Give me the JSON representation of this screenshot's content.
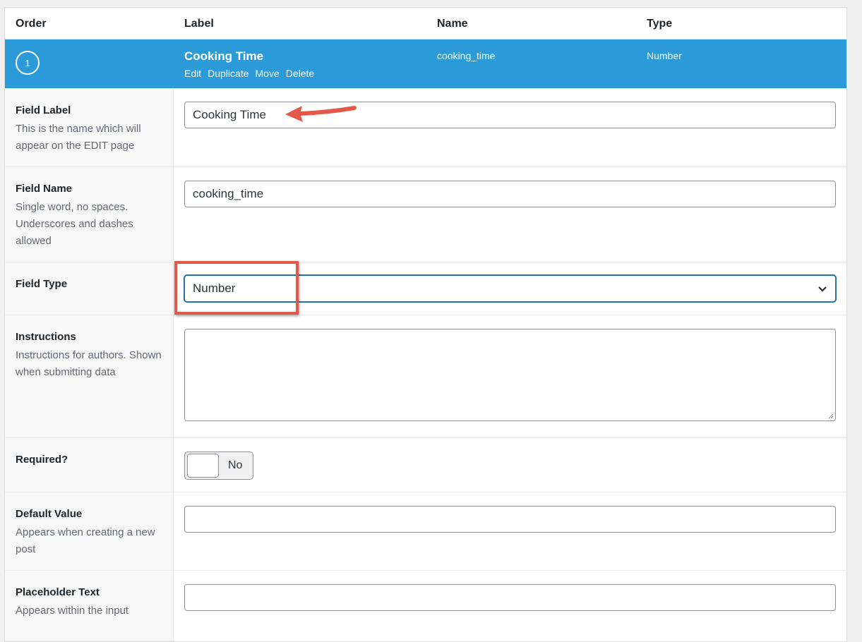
{
  "header": {
    "order": "Order",
    "label": "Label",
    "name": "Name",
    "type": "Type"
  },
  "field": {
    "order": "1",
    "label": "Cooking Time",
    "name": "cooking_time",
    "type": "Number",
    "actions": {
      "edit": "Edit",
      "duplicate": "Duplicate",
      "move": "Move",
      "delete": "Delete"
    }
  },
  "settings": {
    "field_label": {
      "label": "Field Label",
      "description": "This is the name which will appear on the EDIT page",
      "value": "Cooking Time"
    },
    "field_name": {
      "label": "Field Name",
      "description": "Single word, no spaces. Underscores and dashes allowed",
      "value": "cooking_time"
    },
    "field_type": {
      "label": "Field Type",
      "selected": "Number"
    },
    "instructions": {
      "label": "Instructions",
      "description": "Instructions for authors. Shown when submitting data",
      "value": ""
    },
    "required": {
      "label": "Required?",
      "toggle_text": "No",
      "on": false
    },
    "default_value": {
      "label": "Default Value",
      "description": "Appears when creating a new post",
      "value": ""
    },
    "placeholder_text": {
      "label": "Placeholder Text",
      "description": "Appears within the input",
      "value": ""
    }
  },
  "colors": {
    "row_active": "#2a9bd8",
    "annotation": "#e4584a",
    "focus": "#2271b1"
  },
  "icons": {
    "select": "chevron-down-icon",
    "annotation_arrow": "arrow-left-icon"
  }
}
